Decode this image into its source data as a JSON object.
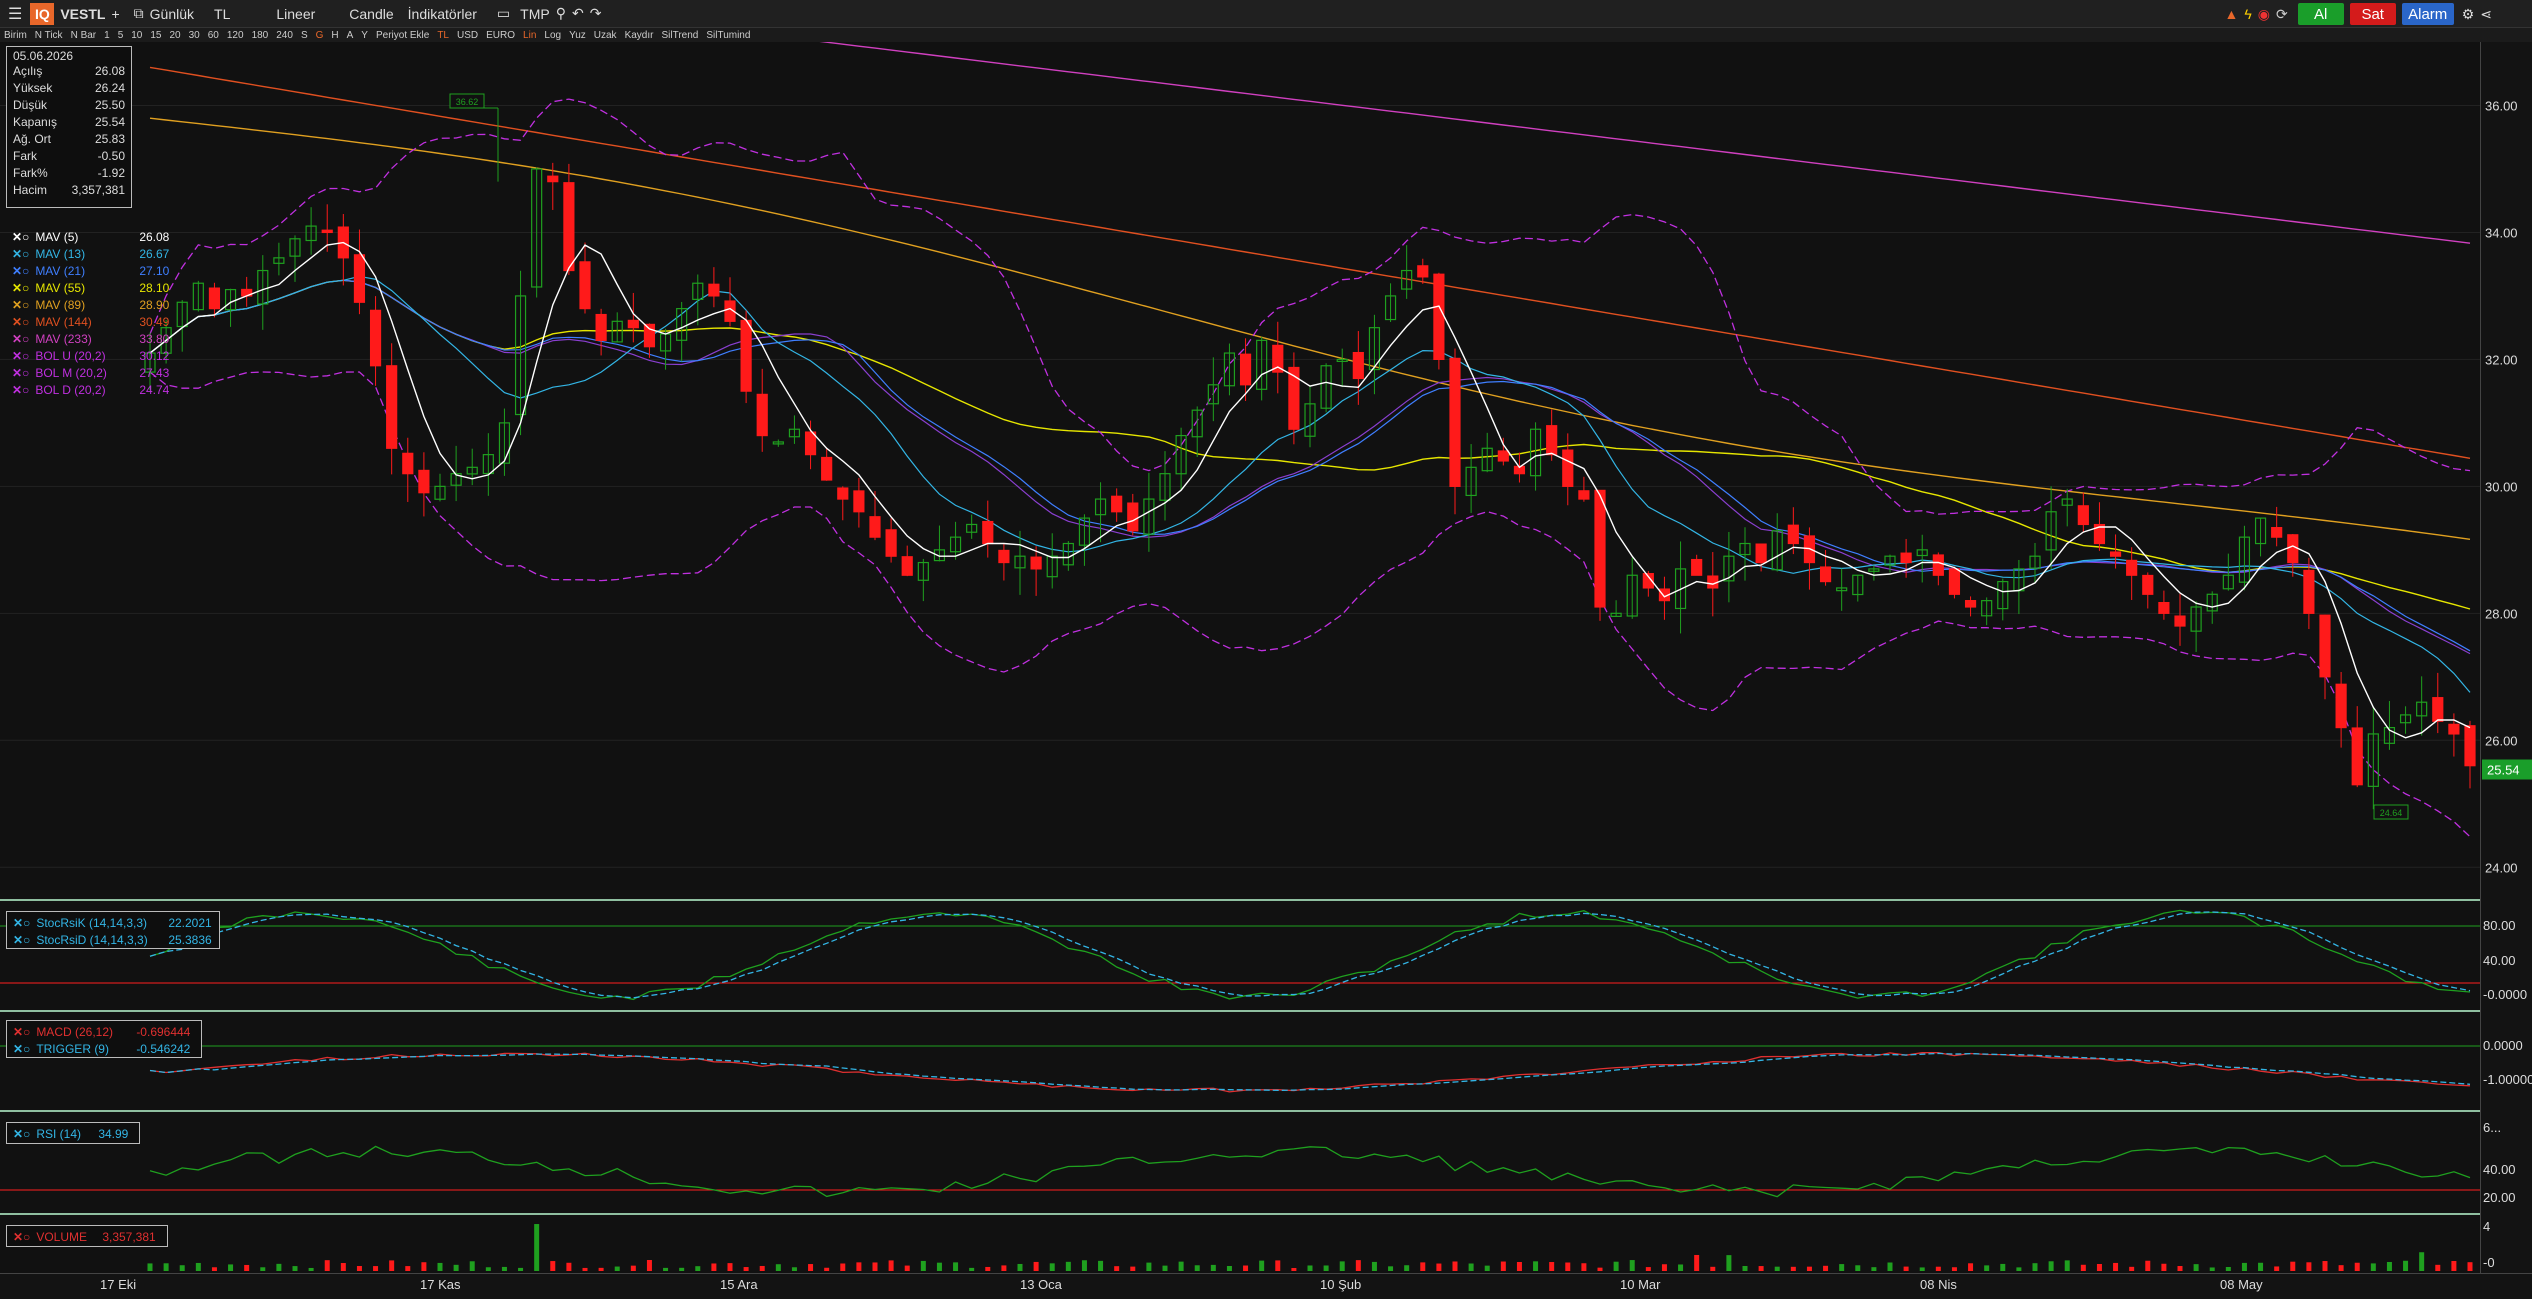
{
  "toolbar": {
    "logo": "IQ",
    "symbol": "VESTL",
    "plus": "+",
    "period": "Günlük",
    "currency": "TL",
    "scale_type": "Lineer",
    "chart_type": "Candle",
    "indicators": "İndikatörler",
    "template": "TMP",
    "buy_label": "Al",
    "sell_label": "Sat",
    "alarm_label": "Alarm"
  },
  "subbar": {
    "items": [
      "Birim",
      "N Tick",
      "N Bar",
      "1",
      "5",
      "10",
      "15",
      "20",
      "30",
      "60",
      "120",
      "180",
      "240",
      "S",
      "G",
      "H",
      "A",
      "Y",
      "Periyot Ekle",
      "TL",
      "USD",
      "EURO",
      "Lin",
      "Log",
      "Yuz",
      "Uzak",
      "Kaydır",
      "SilTrend",
      "SilTumind"
    ]
  },
  "ohlc": {
    "date": "05.06.2026",
    "rows": [
      {
        "label": "Açılış",
        "value": "26.08"
      },
      {
        "label": "Yüksek",
        "value": "26.24"
      },
      {
        "label": "Düşük",
        "value": "25.50"
      },
      {
        "label": "Kapanış",
        "value": "25.54"
      },
      {
        "label": "Ağ. Ort",
        "value": "25.83"
      },
      {
        "label": "Fark",
        "value": "-0.50"
      },
      {
        "label": "Fark%",
        "value": "-1.92"
      },
      {
        "label": "Hacim",
        "value": "3,357,381"
      }
    ]
  },
  "legend": [
    {
      "name": "MAV (5)",
      "value": "26.08",
      "color": "#ffffff"
    },
    {
      "name": "MAV (13)",
      "value": "26.67",
      "color": "#33b5e5"
    },
    {
      "name": "MAV (21)",
      "value": "27.10",
      "color": "#3f7fff"
    },
    {
      "name": "MAV (55)",
      "value": "28.10",
      "color": "#e6e600"
    },
    {
      "name": "MAV (89)",
      "value": "28.90",
      "color": "#e0a020"
    },
    {
      "name": "MAV (144)",
      "value": "30.49",
      "color": "#e05020"
    },
    {
      "name": "MAV (233)",
      "value": "33.80",
      "color": "#d040c0"
    },
    {
      "name": "BOL U (20,2)",
      "value": "30.12",
      "color": "#c030e0"
    },
    {
      "name": "BOL M (20,2)",
      "value": "27.43",
      "color": "#c030e0"
    },
    {
      "name": "BOL D (20,2)",
      "value": "24.74",
      "color": "#c030e0"
    }
  ],
  "price_axis": {
    "ticks": [
      "36.00",
      "34.00",
      "32.00",
      "30.00",
      "28.00",
      "26.00",
      "24.00"
    ],
    "last": "25.54",
    "max_label": "36.62",
    "min_label": "24.64"
  },
  "stochrsi": {
    "k_label": "StocRsiK (14,14,3,3)",
    "k_value": "22.2021",
    "d_label": "StocRsiD (14,14,3,3)",
    "d_value": "25.3836",
    "ticks": [
      "80.00",
      "40.00",
      "-0.0000"
    ]
  },
  "macd": {
    "macd_label": "MACD (26,12)",
    "macd_value": "-0.696444",
    "trig_label": "TRIGGER (9)",
    "trig_value": "-0.546242",
    "ticks": [
      "0.0000",
      "-1.000000"
    ]
  },
  "rsi": {
    "label": "RSI (14)",
    "value": "34.99",
    "ticks": [
      "6...",
      "40.00",
      "20.00"
    ]
  },
  "volume": {
    "label": "VOLUME",
    "value": "3,357,381",
    "ticks": [
      "4",
      "-0"
    ]
  },
  "dates": [
    "17 Eki",
    "17 Kas",
    "15 Ara",
    "13 Oca",
    "10 Şub",
    "10 Mar",
    "08 Nis",
    "08 May"
  ],
  "colors": {
    "up": "#1fa01f",
    "down": "#ff1a1a",
    "bg": "#111111",
    "accent": "#e8672a"
  },
  "chart_data": {
    "type": "candlestick",
    "ylim": [
      23.5,
      37
    ],
    "closes": [
      32.1,
      32.5,
      32.9,
      33.2,
      32.8,
      33.1,
      33.0,
      33.4,
      33.6,
      33.9,
      34.1,
      34.0,
      33.6,
      32.9,
      31.9,
      30.6,
      30.2,
      29.9,
      30.0,
      30.2,
      30.3,
      30.5,
      31.0,
      33.0,
      35.0,
      34.8,
      33.4,
      32.8,
      32.3,
      32.6,
      32.5,
      32.2,
      32.4,
      32.8,
      33.2,
      33.0,
      32.6,
      31.5,
      30.8,
      30.7,
      30.9,
      30.5,
      30.1,
      29.8,
      29.6,
      29.2,
      28.9,
      28.6,
      28.8,
      29.0,
      29.2,
      29.4,
      29.1,
      28.8,
      28.9,
      28.7,
      28.9,
      29.1,
      29.5,
      29.8,
      29.6,
      29.3,
      29.8,
      30.2,
      30.8,
      31.2,
      31.6,
      32.1,
      31.6,
      32.3,
      31.8,
      30.9,
      31.3,
      31.9,
      32.0,
      31.7,
      32.5,
      33.0,
      33.4,
      33.3,
      32.0,
      30.0,
      30.3,
      30.6,
      30.4,
      30.2,
      30.9,
      30.5,
      30.0,
      29.8,
      28.1,
      28.0,
      28.6,
      28.4,
      28.2,
      28.7,
      28.6,
      28.4,
      28.9,
      29.1,
      28.8,
      29.3,
      29.1,
      28.8,
      28.5,
      28.4,
      28.6,
      28.7,
      28.9,
      28.8,
      29.0,
      28.6,
      28.3,
      28.1,
      28.2,
      28.5,
      28.7,
      28.9,
      29.6,
      29.8,
      29.4,
      29.1,
      28.9,
      28.6,
      28.3,
      28.0,
      27.8,
      28.1,
      28.3,
      28.6,
      29.2,
      29.5,
      29.2,
      28.8,
      28.0,
      27.0,
      26.2,
      25.3,
      26.1,
      26.2,
      26.4,
      26.6,
      26.3,
      26.1,
      25.6
    ]
  }
}
